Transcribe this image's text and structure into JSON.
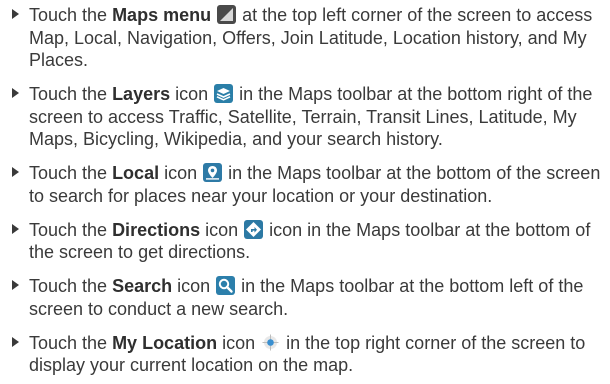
{
  "items": [
    {
      "pre": "Touch the ",
      "kw": "Maps menu",
      "icon": "maps-menu-icon",
      "post": " at the top left corner of the screen to access Map, Local, Navigation, Offers, Join Latitude, Location history, and My Places."
    },
    {
      "pre": "Touch the ",
      "kw": "Layers",
      "mid": " icon ",
      "icon": "layers-icon",
      "post": " in the Maps toolbar at the bottom right of the screen to access Traffic, Satellite, Terrain, Transit Lines, Latitude, My Maps, Bicycling, Wikipedia, and your search history."
    },
    {
      "pre": "Touch the ",
      "kw": "Local",
      "mid": " icon ",
      "icon": "local-icon",
      "post": " in the Maps toolbar at the bottom of the screen to search for places near your location or your destination."
    },
    {
      "pre": "Touch the ",
      "kw": "Directions",
      "mid": " icon ",
      "icon": "directions-icon",
      "post": " icon in the Maps toolbar at the bottom of the screen to get directions."
    },
    {
      "pre": "Touch the ",
      "kw": "Search",
      "mid": " icon ",
      "icon": "search-icon",
      "post": " in the Maps toolbar at the bottom left of the screen to conduct a new search."
    },
    {
      "pre": "Touch the ",
      "kw": "My Location",
      "mid": " icon ",
      "icon": "my-location-icon",
      "post": " in the top right corner of the screen to display your current location on the map."
    }
  ]
}
